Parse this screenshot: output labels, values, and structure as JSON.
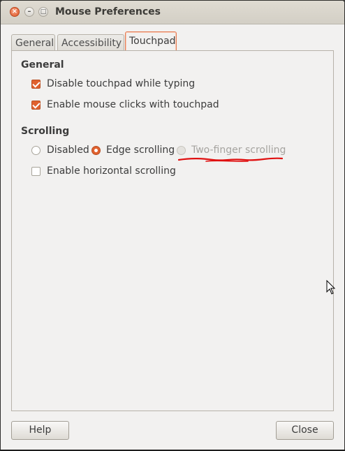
{
  "window": {
    "title": "Mouse Preferences",
    "close_glyph": "×",
    "min_glyph": "–",
    "max_glyph": "□"
  },
  "tabs": [
    {
      "label": "General"
    },
    {
      "label": "Accessibility"
    },
    {
      "label": "Touchpad",
      "selected": true
    }
  ],
  "general": {
    "title": "General",
    "disable_while_typing": {
      "label": "Disable touchpad while typing",
      "checked": true
    },
    "enable_clicks": {
      "label": "Enable mouse clicks with touchpad",
      "checked": true
    }
  },
  "scrolling": {
    "title": "Scrolling",
    "options": [
      {
        "label": "Disabled",
        "selected": false,
        "enabled": true
      },
      {
        "label": "Edge scrolling",
        "selected": true,
        "enabled": true
      },
      {
        "label": "Two-finger scrolling",
        "selected": false,
        "enabled": false
      }
    ],
    "horizontal": {
      "label": "Enable horizontal scrolling",
      "checked": false
    }
  },
  "buttons": {
    "help": "Help",
    "close": "Close"
  },
  "colors": {
    "accent": "#e0612f",
    "annotation": "#e01010"
  },
  "icons": {
    "cursor": "mouse-pointer-icon"
  }
}
